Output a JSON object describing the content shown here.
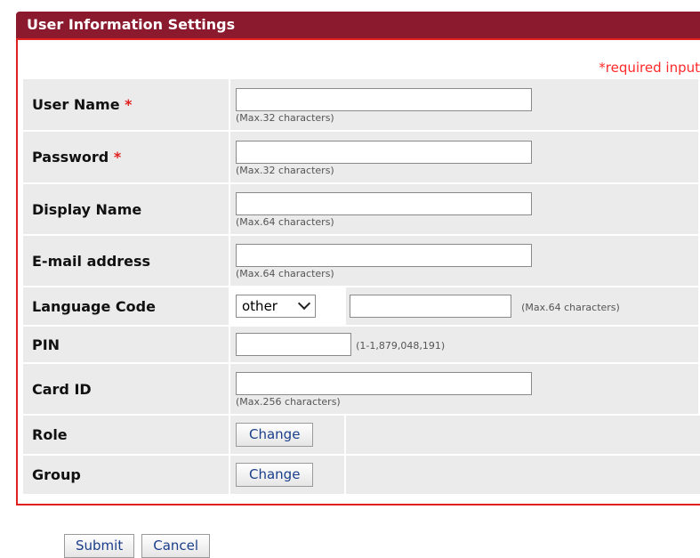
{
  "header": {
    "title": "User Information Settings"
  },
  "required_note": "*required input",
  "fields": {
    "user_name": {
      "label": "User Name",
      "required_mark": "*",
      "hint": "(Max.32 characters)",
      "value": ""
    },
    "password": {
      "label": "Password",
      "required_mark": "*",
      "hint": "(Max.32 characters)",
      "value": ""
    },
    "display_name": {
      "label": "Display Name",
      "hint": "(Max.64 characters)",
      "value": ""
    },
    "email": {
      "label": "E-mail address",
      "hint": "(Max.64 characters)",
      "value": ""
    },
    "language_code": {
      "label": "Language Code",
      "selected": "other",
      "hint": "(Max.64 characters)",
      "value": ""
    },
    "pin": {
      "label": "PIN",
      "hint": "(1-1,879,048,191)",
      "value": ""
    },
    "card_id": {
      "label": "Card ID",
      "hint": "(Max.256 characters)",
      "value": ""
    },
    "role": {
      "label": "Role",
      "button": "Change"
    },
    "group": {
      "label": "Group",
      "button": "Change"
    }
  },
  "footer": {
    "submit": "Submit",
    "cancel": "Cancel"
  },
  "colors": {
    "header_bg": "#8b1a2e",
    "panel_border": "#e0201e",
    "required": "#ff2a2a",
    "button_text": "#1a3e8a"
  }
}
